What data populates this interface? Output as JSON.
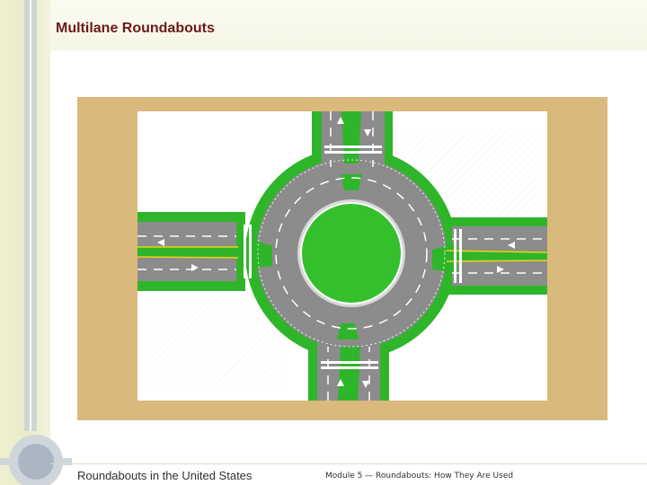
{
  "slide": {
    "title": "Multilane Roundabouts",
    "footer_left": "Roundabouts in the United States",
    "footer_right": "Module 5 — Roundabouts: How They Are Used"
  },
  "colors": {
    "title": "#6b1a1a",
    "frame": "#d9b97c",
    "grass": "#2fb52a",
    "pavement": "#8a8a8a",
    "band": "#e9ecc8"
  },
  "figure": {
    "subject": "multilane roundabout plan view",
    "legs": [
      "north",
      "east",
      "south",
      "west"
    ],
    "lanes_per_approach": 2
  }
}
